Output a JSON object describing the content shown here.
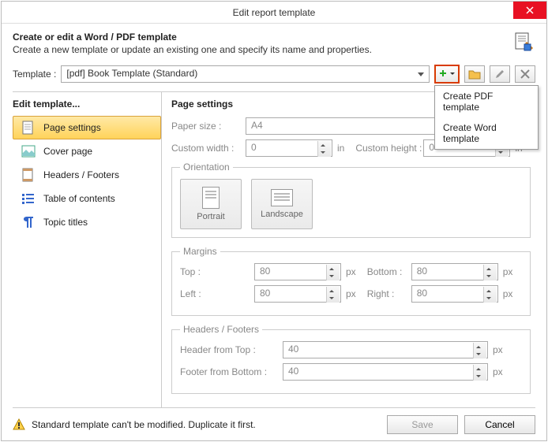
{
  "title": "Edit report template",
  "header": {
    "title": "Create or edit a Word / PDF template",
    "subtitle": "Create a new template or update an existing one and specify its name and properties."
  },
  "template": {
    "label": "Template :",
    "value": "[pdf] Book Template (Standard)"
  },
  "dropdown": {
    "pdf": "Create PDF template",
    "word": "Create Word template"
  },
  "sidebar": {
    "title": "Edit template...",
    "items": [
      {
        "label": "Page settings"
      },
      {
        "label": "Cover page"
      },
      {
        "label": "Headers / Footers"
      },
      {
        "label": "Table of contents"
      },
      {
        "label": "Topic titles"
      }
    ]
  },
  "main": {
    "title": "Page settings",
    "paper_label": "Paper size :",
    "paper_value": "A4",
    "custom_w_label": "Custom width :",
    "custom_w_value": "0",
    "custom_h_label": "Custom height :",
    "custom_h_value": "0",
    "unit_in": "in",
    "orientation_legend": "Orientation",
    "portrait": "Portrait",
    "landscape": "Landscape",
    "margins_legend": "Margins",
    "top_label": "Top :",
    "top_value": "80",
    "bottom_label": "Bottom :",
    "bottom_value": "80",
    "left_label": "Left :",
    "left_value": "80",
    "right_label": "Right :",
    "right_value": "80",
    "unit_px": "px",
    "hf_legend": "Headers / Footers",
    "hft_label": "Header from Top :",
    "hft_value": "40",
    "ffb_label": "Footer from Bottom :",
    "ffb_value": "40"
  },
  "footer": {
    "warning": "Standard template can't be modified. Duplicate it first.",
    "save": "Save",
    "cancel": "Cancel"
  }
}
